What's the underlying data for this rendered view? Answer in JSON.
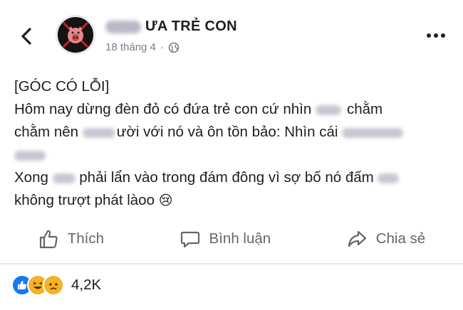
{
  "header": {
    "page_name": "ƯA TRẺ CON",
    "date": "18 tháng 4",
    "dot": "·",
    "icons": {
      "back": "chevron-left-icon",
      "privacy": "globe-icon",
      "more": "more-horizontal-icon"
    }
  },
  "post": {
    "lines": [
      [
        "[GÓC CÓ LỖI]"
      ],
      [
        "Hôm nay dừng đèn đỏ có đứa trẻ con cứ nhìn ",
        "chằm"
      ],
      [
        "chằm nên ",
        "ười với nó và ôn tồn bảo: Nhìn cái "
      ],
      [
        ""
      ],
      [
        "Xong ",
        " phải lẩn vào trong đám đông vì sợ bố nó đấm "
      ],
      [
        "không trượt phát làoo ",
        "😢"
      ]
    ]
  },
  "actions": {
    "like": "Thích",
    "comment": "Bình luận",
    "share": "Chia sẻ"
  },
  "reactions": {
    "types": [
      "like-icon",
      "haha-icon",
      "sad-icon"
    ],
    "count": "4,2K"
  },
  "colors": {
    "text": "#1c1e21",
    "muted": "#606770",
    "like_blue": "#1877f2",
    "react_yellow": "#f7b125"
  }
}
